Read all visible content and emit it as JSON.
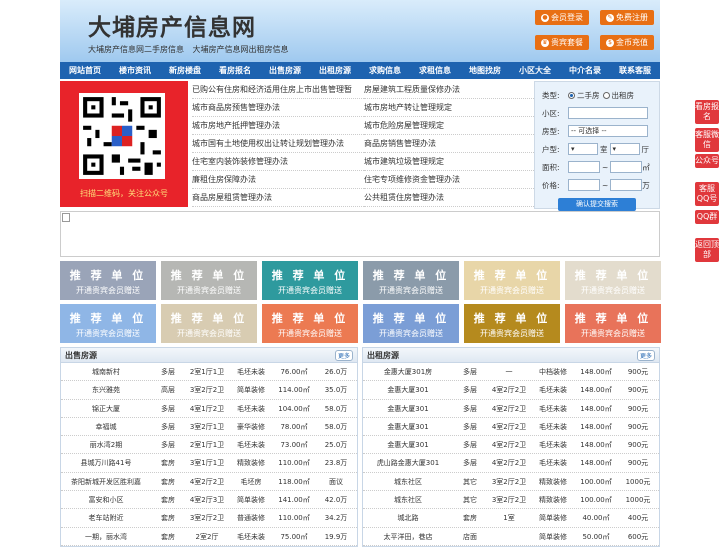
{
  "header": {
    "title": "大埔房产信息网",
    "sub1": "大埔房产信息网二手房信息",
    "sub2": "大埔房产信息网出租房信息",
    "btn_login": "会员登录",
    "btn_register": "免费注册",
    "btn_vip": "贵宾套餐",
    "btn_recharge": "金币充值"
  },
  "nav": [
    "网站首页",
    "楼市资讯",
    "新房楼盘",
    "看房报名",
    "出售房源",
    "出租房源",
    "求购信息",
    "求租信息",
    "地图找房",
    "小区大全",
    "中介名录",
    "联系客服"
  ],
  "qr": {
    "caption": "扫描二维码，关注公众号"
  },
  "links": [
    "已购公有住房和经济适用住房上市出售管理暂",
    "房屋建筑工程质量保修办法",
    "城市商品房预售管理办法",
    "城市房地产转让管理规定",
    "城市房地产抵押管理办法",
    "城市危险房屋管理规定",
    "城市国有土地使用权出让转让规划管理办法",
    "商品房销售管理办法",
    "住宅室内装饰装修管理办法",
    "城市建筑垃圾管理规定",
    "廉租住房保障办法",
    "住宅专项维修资金管理办法",
    "商品房屋租赁管理办法",
    "公共租赁住房管理办法"
  ],
  "search": {
    "type_label": "类型:",
    "type_opt1": "二手房",
    "type_opt2": "出租房",
    "community_label": "小区:",
    "house_label": "房型:",
    "house_value": "-- 可选择 --",
    "layout_label": "户型:",
    "room": "室",
    "hall": "厅",
    "area_label": "面积:",
    "area_unit": "㎡",
    "price_label": "价格:",
    "price_unit": "万",
    "submit": "确认提交搜索"
  },
  "ads": [
    {
      "t1": "推 荐 单 位",
      "t2": "开通贵宾会员赠送",
      "color": "#9aa4b8"
    },
    {
      "t1": "推 荐 单 位",
      "t2": "开通贵宾会员赠送",
      "color": "#b6b7b4"
    },
    {
      "t1": "推 荐 单 位",
      "t2": "开通贵宾会员赠送",
      "color": "#2e9a9e"
    },
    {
      "t1": "推 荐 单 位",
      "t2": "开通贵宾会员赠送",
      "color": "#8b9baa"
    },
    {
      "t1": "推 荐 单 位",
      "t2": "开通贵宾会员赠送",
      "color": "#e8d6a8"
    },
    {
      "t1": "推 荐 单 位",
      "t2": "开通贵宾会员赠送",
      "color": "#e3dccd"
    },
    {
      "t1": "推 荐 单 位",
      "t2": "开通贵宾会员赠送",
      "color": "#8fb6e6"
    },
    {
      "t1": "推 荐 单 位",
      "t2": "开通贵宾会员赠送",
      "color": "#d8ccb2"
    },
    {
      "t1": "推 荐 单 位",
      "t2": "开通贵宾会员赠送",
      "color": "#ec7a52"
    },
    {
      "t1": "推 荐 单 位",
      "t2": "开通贵宾会员赠送",
      "color": "#7b9ed6"
    },
    {
      "t1": "推 荐 单 位",
      "t2": "开通贵宾会员赠送",
      "color": "#b58a1e"
    },
    {
      "t1": "推 荐 单 位",
      "t2": "开通贵宾会员赠送",
      "color": "#e8735a"
    }
  ],
  "sale": {
    "title": "出售房源",
    "more": "更多",
    "rows": [
      [
        "城南新村",
        "多层",
        "2室1厅1卫",
        "毛坯未装",
        "76.00㎡",
        "26.0万"
      ],
      [
        "东兴雅苑",
        "高层",
        "3室2厅2卫",
        "简单装修",
        "114.00㎡",
        "35.0万"
      ],
      [
        "锦正大厦",
        "多层",
        "4室1厅2卫",
        "毛坯未装",
        "104.00㎡",
        "58.0万"
      ],
      [
        "幸福城",
        "多层",
        "3室2厅1卫",
        "豪华装修",
        "78.00㎡",
        "58.0万"
      ],
      [
        "丽水湾2期",
        "多层",
        "2室1厅1卫",
        "毛坯未装",
        "73.00㎡",
        "25.0万"
      ],
      [
        "县城万川路41号",
        "套房",
        "3室1厅1卫",
        "精致装修",
        "110.00㎡",
        "23.8万"
      ],
      [
        "茶阳新城开发区胜利嘉",
        "套房",
        "4室2厅2卫",
        "毛坯房",
        "118.00㎡",
        "面议"
      ],
      [
        "富安和小区",
        "套房",
        "4室2厅3卫",
        "简单装修",
        "141.00㎡",
        "42.0万"
      ],
      [
        "老车站附近",
        "套房",
        "3室2厅2卫",
        "普通装修",
        "110.00㎡",
        "34.2万"
      ],
      [
        "一期，丽水湾",
        "套房",
        "2室2厅",
        "毛坯未装",
        "75.00㎡",
        "19.9万"
      ]
    ]
  },
  "rent": {
    "title": "出租房源",
    "more": "更多",
    "rows": [
      [
        "金惠大厦301房",
        "多层",
        "一",
        "中档装修",
        "148.00㎡",
        "900元"
      ],
      [
        "金惠大厦301",
        "多层",
        "4室2厅2卫",
        "毛坯未装",
        "148.00㎡",
        "900元"
      ],
      [
        "金惠大厦301",
        "多层",
        "4室2厅2卫",
        "毛坯未装",
        "148.00㎡",
        "900元"
      ],
      [
        "金惠大厦301",
        "多层",
        "4室2厅2卫",
        "毛坯未装",
        "148.00㎡",
        "900元"
      ],
      [
        "金惠大厦301",
        "多层",
        "4室2厅2卫",
        "毛坯未装",
        "148.00㎡",
        "900元"
      ],
      [
        "虎山路金惠大厦301",
        "多层",
        "4室2厅2卫",
        "毛坯未装",
        "148.00㎡",
        "900元"
      ],
      [
        "城东社区",
        "其它",
        "3室2厅2卫",
        "精致装修",
        "100.00㎡",
        "1000元"
      ],
      [
        "城东社区",
        "其它",
        "3室2厅2卫",
        "精致装修",
        "100.00㎡",
        "1000元"
      ],
      [
        "城北路",
        "套房",
        "1室",
        "简单装修",
        "40.00㎡",
        "400元"
      ],
      [
        "太平洋田，巷店",
        "店面",
        "",
        "简单装修",
        "50.00㎡",
        "600元"
      ]
    ]
  },
  "side": [
    "看房报名",
    "客服微信",
    "公众号",
    "客服QQ号",
    "QQ群",
    "返回顶部"
  ]
}
